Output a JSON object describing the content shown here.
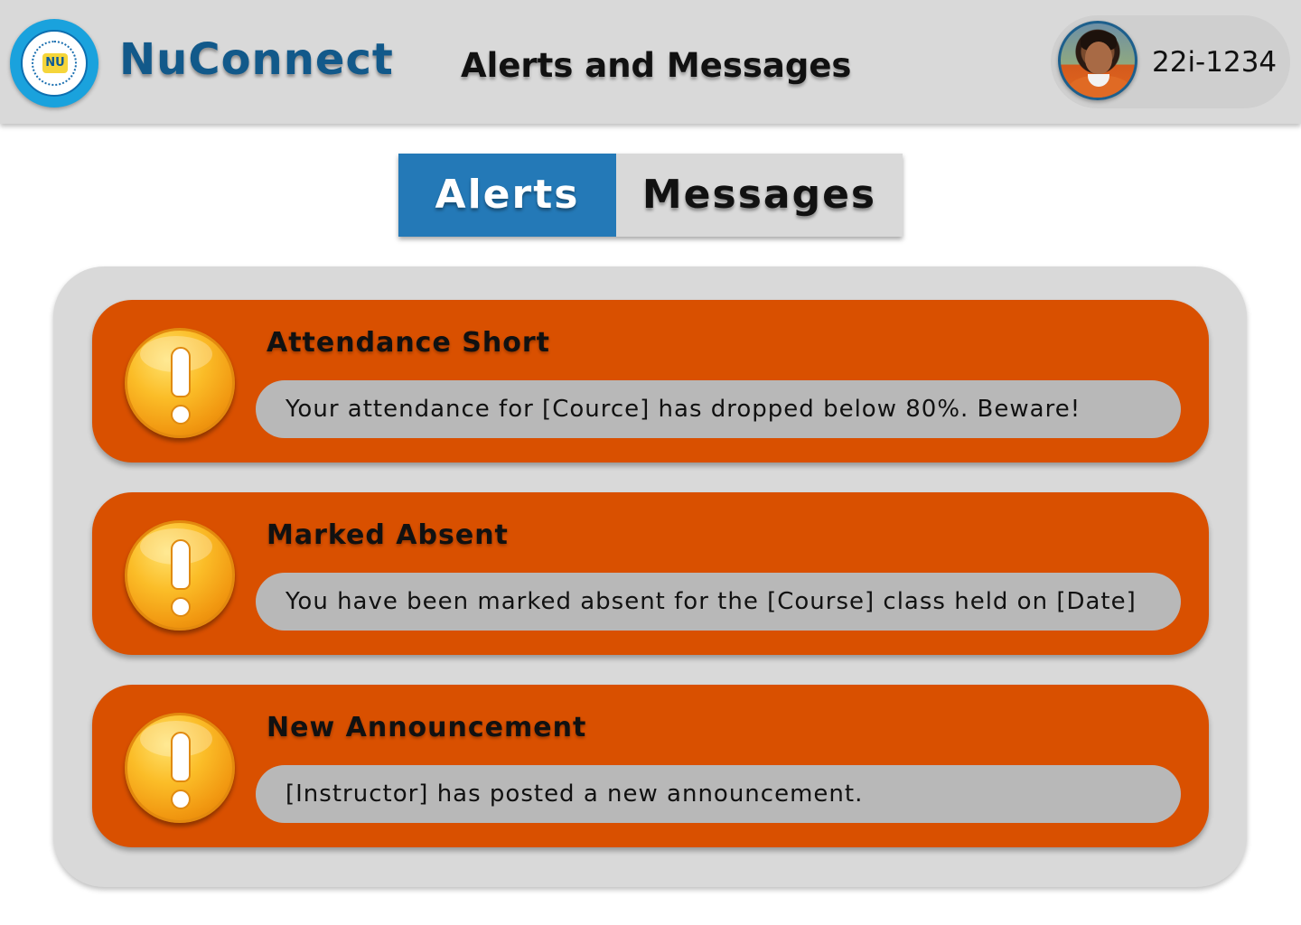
{
  "header": {
    "app_name": "NuConnect",
    "page_title": "Alerts and Messages",
    "user_id": "22i-1234",
    "logo_mark": "NU"
  },
  "tabs": [
    {
      "label": "Alerts",
      "active": true
    },
    {
      "label": "Messages",
      "active": false
    }
  ],
  "alerts": [
    {
      "title": "Attendance Short",
      "message": "Your attendance for [Cource] has dropped below 80%. Beware!",
      "icon": "exclamation-icon"
    },
    {
      "title": "Marked Absent",
      "message": "You have been marked absent for the [Course] class held on [Date]",
      "icon": "exclamation-icon"
    },
    {
      "title": "New Announcement",
      "message": "[Instructor] has posted a new announcement.",
      "icon": "exclamation-icon"
    }
  ],
  "colors": {
    "header_bg": "#d9d9d9",
    "brand_blue": "#12598a",
    "active_tab": "#2479b7",
    "alert_card": "#d95000",
    "message_pill": "#b8b8b8",
    "panel_bg": "#d9d9d9"
  }
}
